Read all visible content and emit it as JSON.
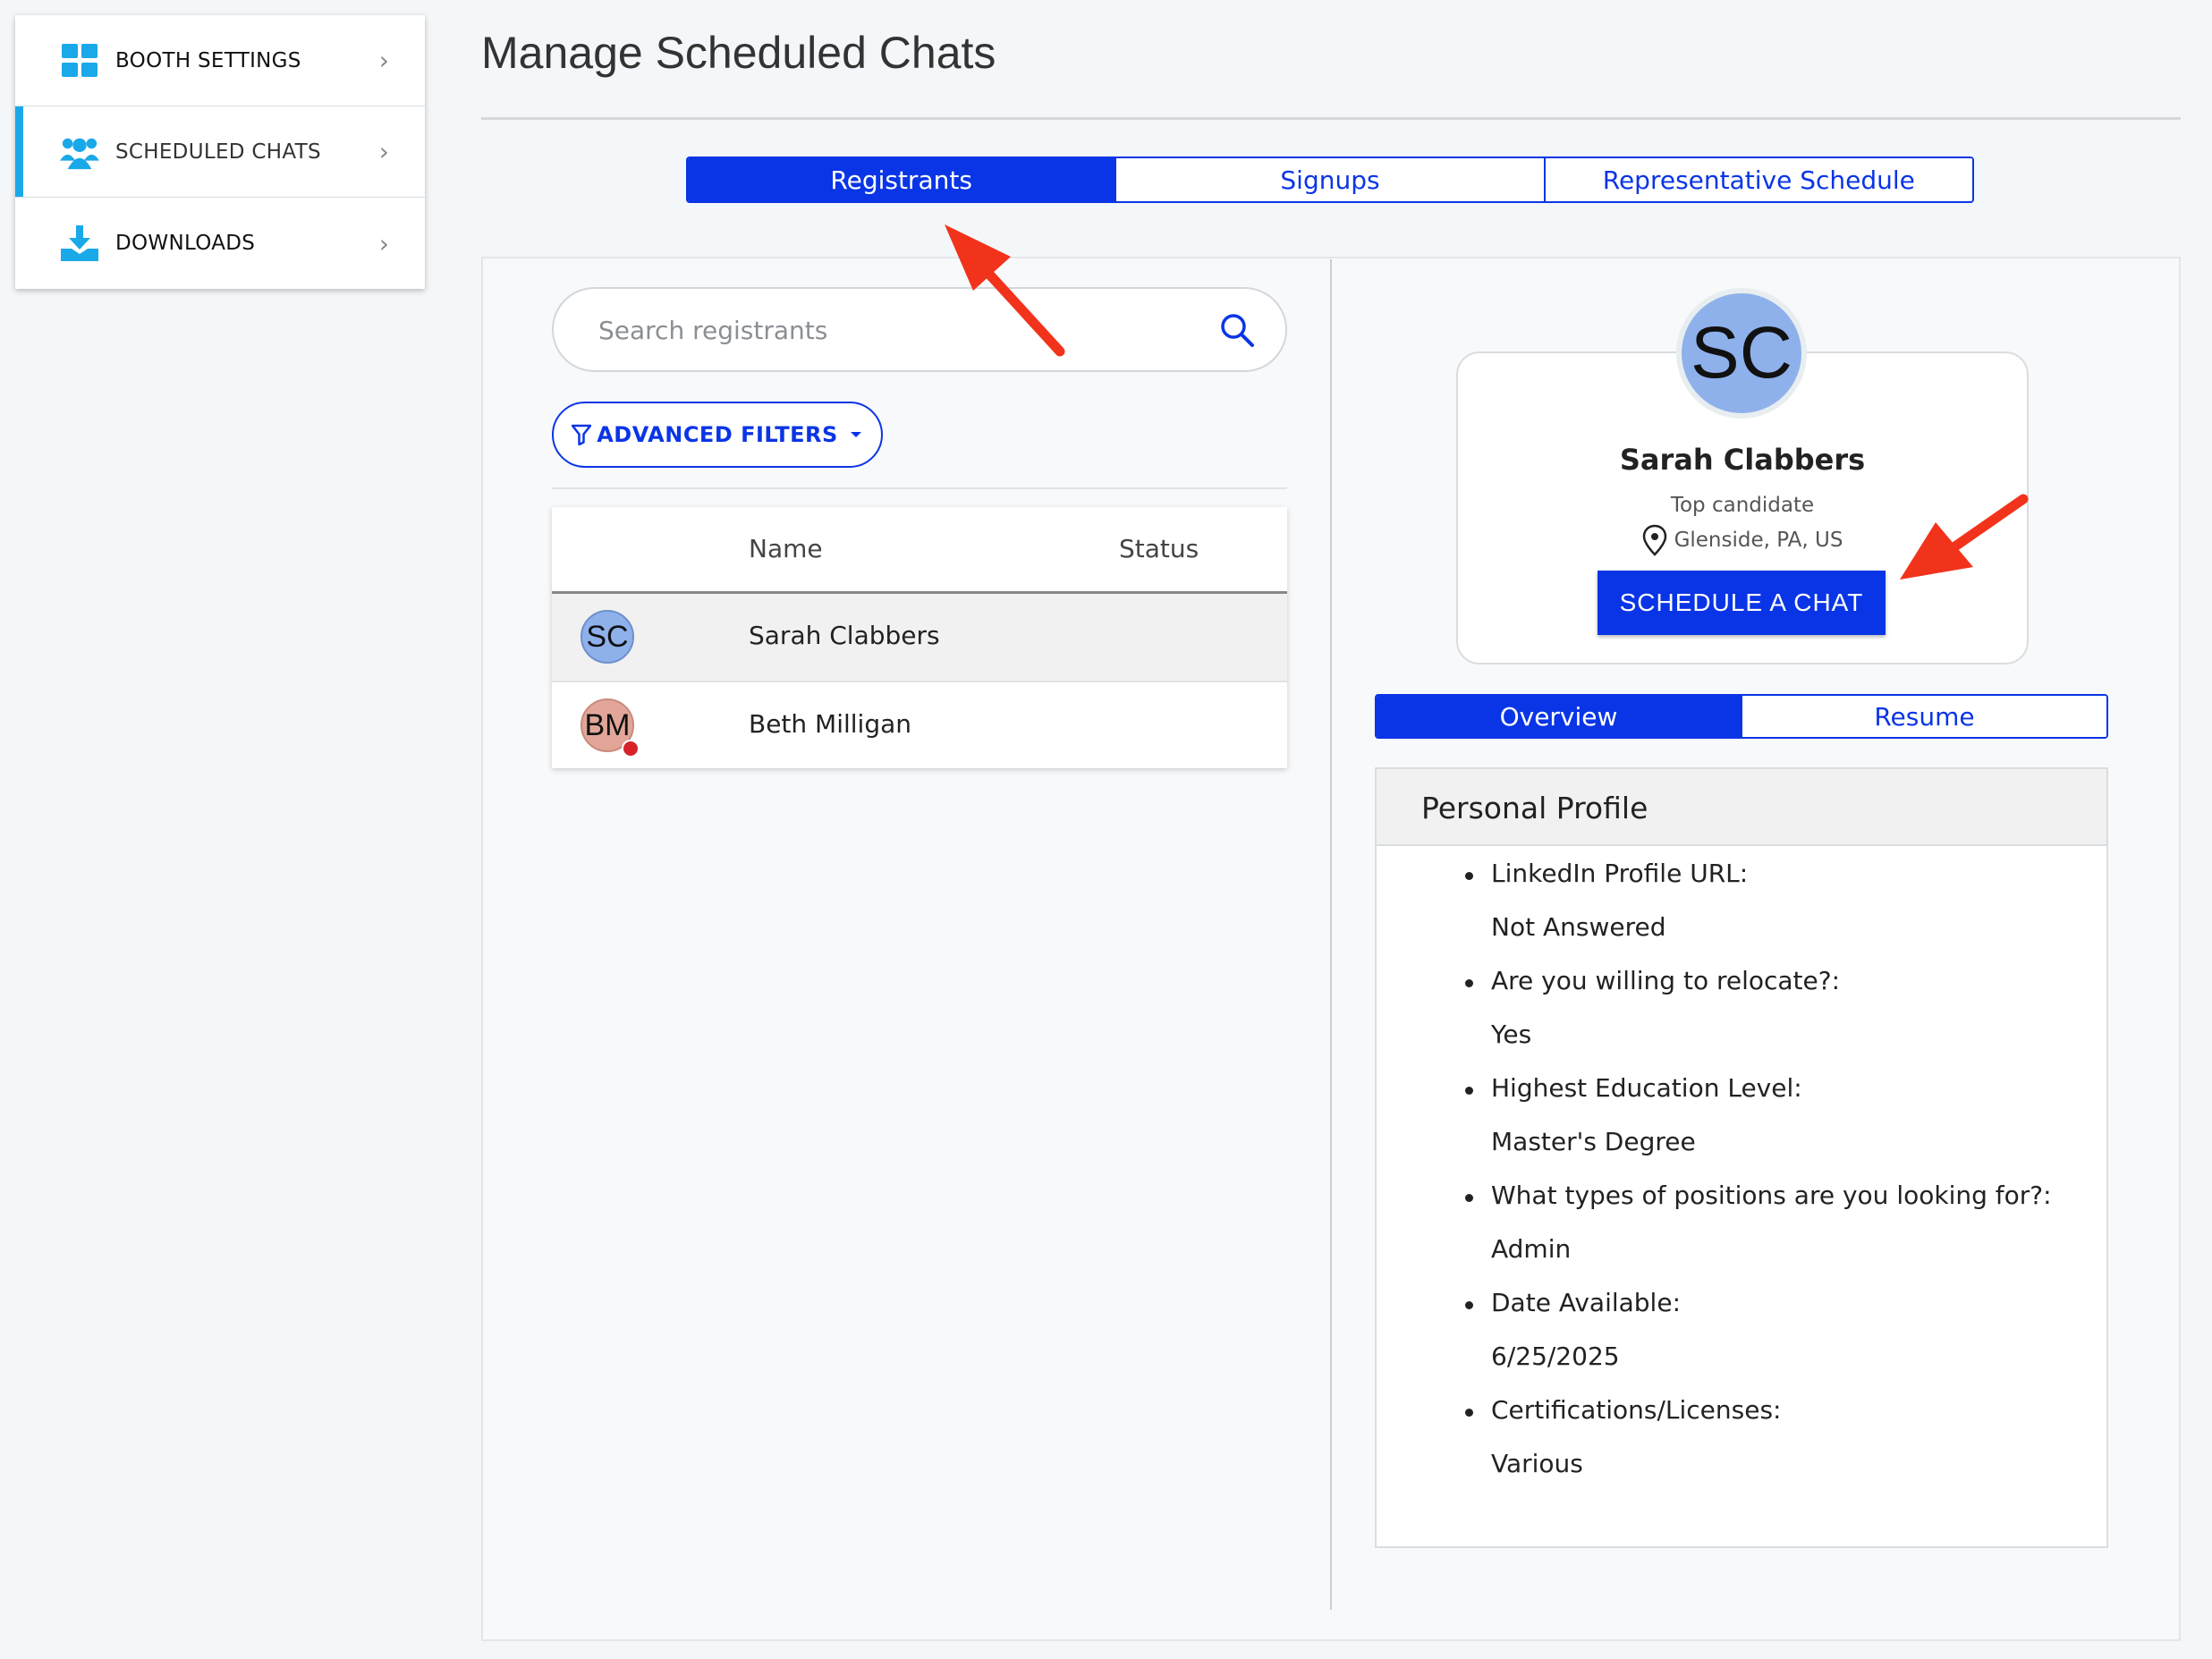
{
  "sidebar": {
    "items": [
      {
        "label": "BOOTH SETTINGS",
        "icon": "grid-icon"
      },
      {
        "label": "SCHEDULED CHATS",
        "icon": "users-icon"
      },
      {
        "label": "DOWNLOADS",
        "icon": "download-icon"
      }
    ]
  },
  "header": {
    "title": "Manage Scheduled Chats"
  },
  "tabs": [
    "Registrants",
    "Signups",
    "Representative Schedule"
  ],
  "search": {
    "placeholder": "Search registrants"
  },
  "filters": {
    "label": "ADVANCED FILTERS"
  },
  "table": {
    "columns": [
      "Name",
      "Status"
    ],
    "rows": [
      {
        "initials": "SC",
        "name": "Sarah Clabbers",
        "status": ""
      },
      {
        "initials": "BM",
        "name": "Beth Milligan",
        "status": ""
      }
    ]
  },
  "profile": {
    "initials": "SC",
    "name": "Sarah Clabbers",
    "tag": "Top candidate",
    "location": "Glenside, PA, US",
    "schedule_label": "SCHEDULE A CHAT",
    "tabs": [
      "Overview",
      "Resume"
    ],
    "section_title": "Personal Profile",
    "fields": [
      {
        "q": "LinkedIn Profile URL:",
        "a": "Not Answered"
      },
      {
        "q": "Are you willing to relocate?:",
        "a": "Yes"
      },
      {
        "q": "Highest Education Level:",
        "a": "Master's Degree"
      },
      {
        "q": "What types of positions are you looking for?:",
        "a": "Admin"
      },
      {
        "q": "Date Available:",
        "a": "6/25/2025"
      },
      {
        "q": "Certifications/Licenses:",
        "a": "Various"
      }
    ]
  },
  "colors": {
    "primary": "#0a35e6",
    "accent": "#1aa9e8",
    "annotation": "#f2331b"
  }
}
